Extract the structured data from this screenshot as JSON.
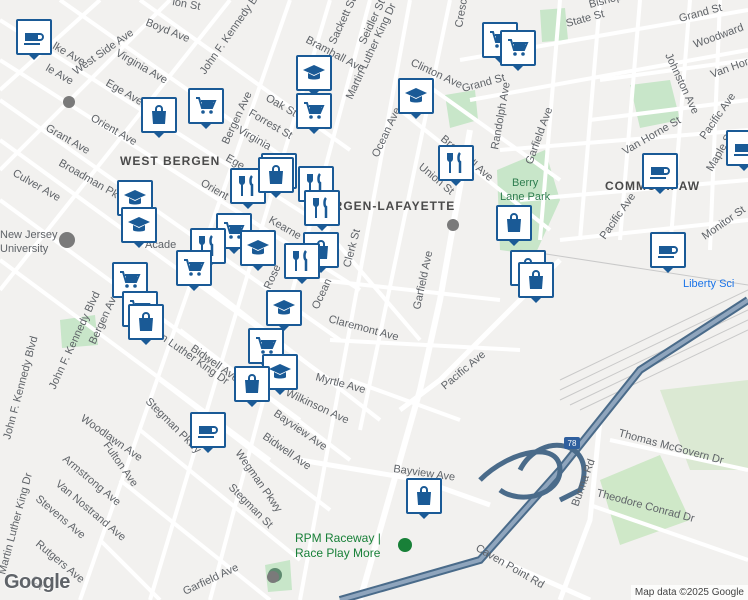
{
  "map": {
    "attribution": "Map data ©2025 Google",
    "logo": "Google",
    "neighborhoods": [
      "WEST BERGEN",
      "BERGEN-LAFAYETTE",
      "COMMUNIPAW"
    ],
    "parks": [
      "Berry",
      "Lane Park"
    ],
    "places": {
      "university": "New Jersey",
      "university2": "University",
      "academy": "Acade",
      "liberty": "Liberty Sci",
      "raceway1": "RPM Raceway |",
      "raceway2": "Race Play More"
    },
    "highway_shield": "78",
    "streets": {
      "boyd": "Boyd Ave",
      "west_side": "West Side Ave",
      "virginia1": "Virginia Ave",
      "ege1": "Ege Ave",
      "orient1": "Orient Ave",
      "grant": "Grant Ave",
      "broadman": "Broadman Pkwy",
      "culver": "Culver Ave",
      "jfk1": "John F. Kennedy Blvd",
      "jfk2": "John F. Kennedy Blvd",
      "jfk3": "John F. Kennedy Blvd",
      "bergen1": "Bergen Ave",
      "bergen2": "Bergen Ave",
      "forrest": "Forrest St",
      "oak": "Oak St",
      "virginia2": "Virginia",
      "ege2": "Ege",
      "orient2": "Orient",
      "kearney": "Kearne",
      "bramhall": "Bramhall Ave",
      "sackett": "Sackett St",
      "seidler": "Seidler St",
      "mlk1": "Martin Luther King Dr",
      "mlk2": "Martin Luther King Dr",
      "mlk3": "Martin Luther King Dr",
      "clinton": "Clinton Ave",
      "ocean": "Ocean Ave",
      "grand1": "Grand St",
      "grand2": "Grand St",
      "state": "State St",
      "randolph": "Randolph Ave",
      "garfield1": "Garfield Ave",
      "garfield2": "Garfield Ave",
      "garfield3": "Garfield Ave",
      "union": "Union St",
      "bramhall2": "Bramhall Ave",
      "johnston": "Johnston Ave",
      "woodward": "Woodward",
      "van_horne1": "Van Horne",
      "van_horne2": "Van Horne St",
      "pacific1": "Pacific Ave",
      "pacific2": "Pacific Ave",
      "pacific3": "Pacific Ave",
      "maple": "Maple St",
      "monitor": "Monitor St",
      "clerk": "Clerk St",
      "claremont": "Claremont Ave",
      "myrtle": "Myrtle Ave",
      "wilkinson": "Wilkinson Ave",
      "bidwell1": "Bidwell Ave",
      "bidwell2": "Bidwell Ave",
      "bayview1": "Bayview Ave",
      "bayview2": "Bayview Ave",
      "wegman": "Wegman Pkwy",
      "stegman1": "Stegman Pkwy",
      "stegman2": "Stegman St",
      "woodlawn": "Woodlawn Ave",
      "fulton": "Fulton Ave",
      "armstrong": "Armstrong Ave",
      "van_nostrand": "Van Nostrand Ave",
      "stevens": "Stevens Ave",
      "rutgers": "Rutgers Ave",
      "thomas": "Thomas McGovern Dr",
      "theodore": "Theodore Conrad Dr",
      "burma": "Burma Rd",
      "caven": "Caven Point Rd",
      "rose": "Rose",
      "ocean2": "Ocean",
      "crescent": "Cresc",
      "bishop": "Bishop St",
      "ca": "Ca",
      "lke": "lke Ave",
      "le": "le Ave",
      "ion": "ion St"
    }
  },
  "markers": [
    {
      "icon": "coffee-icon"
    },
    {
      "icon": "cart-icon"
    },
    {
      "icon": "cart-icon"
    },
    {
      "icon": "school-icon"
    },
    {
      "icon": "cart-icon"
    },
    {
      "icon": "school-icon"
    },
    {
      "icon": "bag-icon"
    },
    {
      "icon": "cart-icon"
    },
    {
      "icon": "restaurant-icon"
    },
    {
      "icon": "bag-icon"
    },
    {
      "icon": "coffee-icon"
    },
    {
      "icon": "coffee-icon"
    },
    {
      "icon": "restaurant-icon"
    },
    {
      "icon": "bag-icon"
    },
    {
      "icon": "school-icon"
    },
    {
      "icon": "school-icon"
    },
    {
      "icon": "restaurant-icon"
    },
    {
      "icon": "restaurant-icon"
    },
    {
      "icon": "cart-icon"
    },
    {
      "icon": "restaurant-icon"
    },
    {
      "icon": "school-icon"
    },
    {
      "icon": "bag-icon"
    },
    {
      "icon": "restaurant-icon"
    },
    {
      "icon": "cart-icon"
    },
    {
      "icon": "cart-icon"
    },
    {
      "icon": "school-icon"
    },
    {
      "icon": "cart-icon"
    },
    {
      "icon": "bag-icon"
    },
    {
      "icon": "cart-icon"
    },
    {
      "icon": "school-icon"
    },
    {
      "icon": "bag-icon"
    },
    {
      "icon": "coffee-icon"
    },
    {
      "icon": "bag-icon"
    },
    {
      "icon": "bag-icon"
    },
    {
      "icon": "bag-icon"
    },
    {
      "icon": "coffee-icon"
    },
    {
      "icon": "bag-icon"
    }
  ]
}
